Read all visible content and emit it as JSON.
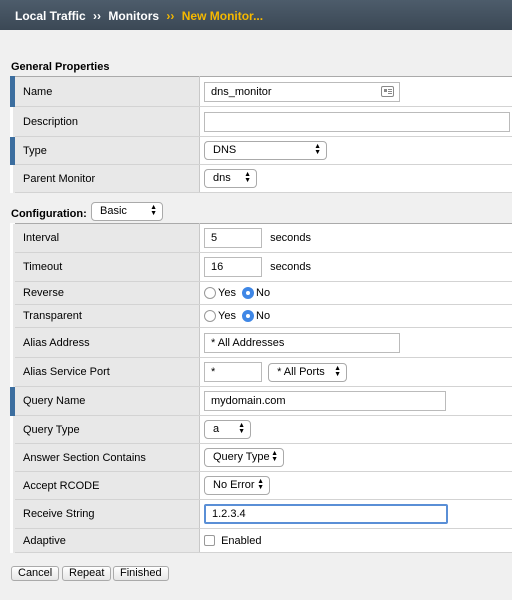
{
  "breadcrumb": {
    "items": [
      "Local Traffic",
      "Monitors"
    ],
    "current": "New Monitor...",
    "separator": "››"
  },
  "general": {
    "heading": "General Properties",
    "name_label": "Name",
    "name_value": "dns_monitor",
    "description_label": "Description",
    "description_value": "",
    "type_label": "Type",
    "type_value": "DNS",
    "parent_label": "Parent Monitor",
    "parent_value": "dns"
  },
  "configuration": {
    "heading": "Configuration:",
    "mode_value": "Basic",
    "interval_label": "Interval",
    "interval_value": "5",
    "interval_unit": "seconds",
    "timeout_label": "Timeout",
    "timeout_value": "16",
    "timeout_unit": "seconds",
    "reverse_label": "Reverse",
    "reverse_yes": "Yes",
    "reverse_no": "No",
    "reverse_selected": "No",
    "transparent_label": "Transparent",
    "transparent_yes": "Yes",
    "transparent_no": "No",
    "transparent_selected": "No",
    "alias_address_label": "Alias Address",
    "alias_address_value": "* All Addresses",
    "alias_port_label": "Alias Service Port",
    "alias_port_value": "*",
    "alias_port_select": "* All Ports",
    "query_name_label": "Query Name",
    "query_name_value": "mydomain.com",
    "query_type_label": "Query Type",
    "query_type_value": "a",
    "answer_label": "Answer Section Contains",
    "answer_value": "Query Type",
    "rcode_label": "Accept RCODE",
    "rcode_value": "No Error",
    "receive_label": "Receive String",
    "receive_value": "1.2.3.4",
    "adaptive_label": "Adaptive",
    "adaptive_text": "Enabled",
    "adaptive_checked": false
  },
  "actions": {
    "cancel": "Cancel",
    "repeat": "Repeat",
    "finished": "Finished"
  },
  "colors": {
    "accent_required": "#3c6e9f",
    "titlebar": "#44525f",
    "current_crumb": "#f5b800",
    "radio_selected": "#3f87e6"
  }
}
